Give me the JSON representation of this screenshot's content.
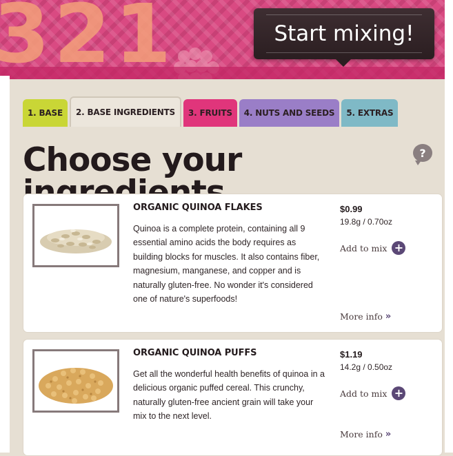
{
  "banner": {
    "countdown_text": "321",
    "start_button_label": "Start mixing!",
    "colors": {
      "banner": "#d94a82",
      "button": "#2b1e21"
    }
  },
  "tabs": [
    {
      "label": "1. BASE",
      "color": "#c9d636",
      "active": false
    },
    {
      "label": "2. BASE INGREDIENTS",
      "color": "#ece6dc",
      "active": true
    },
    {
      "label": "3. FRUITS",
      "color": "#e0357b",
      "active": false
    },
    {
      "label": "4. NUTS AND SEEDS",
      "color": "#9a7ec7",
      "active": false
    },
    {
      "label": "5. EXTRAS",
      "color": "#7fb9c6",
      "active": false
    }
  ],
  "page": {
    "heading": "Choose your ingredients",
    "help_icon_text": "?"
  },
  "products": [
    {
      "name": "ORGANIC QUINOA FLAKES",
      "description": "Quinoa is a complete protein, containing all 9 essential amino acids the body requires as building blocks for muscles. It also contains fiber, magnesium, manganese, and copper and is naturally gluten-free. No wonder it's considered one of nature's superfoods!",
      "price": "$0.99",
      "size": "19.8g / 0.70oz",
      "add_label": "Add to mix",
      "more_label": "More info",
      "image_icon": "quinoa-flakes-image"
    },
    {
      "name": "ORGANIC QUINOA PUFFS",
      "description": "Get all the wonderful health benefits of quinoa in a delicious organic puffed cereal. This crunchy, naturally gluten-free ancient grain will take your mix to the next level.",
      "price": "$1.19",
      "size": "14.2g / 0.50oz",
      "add_label": "Add to mix",
      "more_label": "More info",
      "image_icon": "quinoa-puffs-image"
    }
  ],
  "icons": {
    "add": "+",
    "more": "»"
  },
  "accent_color": "#5b4876"
}
